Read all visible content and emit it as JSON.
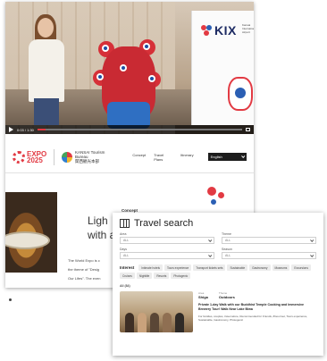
{
  "video": {
    "time": "0:03 / 1:30",
    "progress": 0.04,
    "kix_logo_text": "KIX",
    "kix_subtitle": "Kansai International Airport"
  },
  "site": {
    "expo_line1": "EXPO",
    "expo_line2": "2025",
    "kb_line1": "KANSAI Tourism Bureau",
    "kb_line2": "関西観光本部",
    "nav": [
      "Concept",
      "Travel Plans",
      "Itinerary"
    ],
    "language": "English",
    "hero_line1": "Ligh",
    "hero_line2": "with a tri",
    "concept_label": "Concept",
    "copy_line1": "The World Expo is c",
    "copy_line2": "the theme of \"Desig",
    "copy_line3": "Our Lifes\". The even"
  },
  "travel_search": {
    "title": "Travel search",
    "fields": [
      {
        "label": "Area",
        "value": "ALL"
      },
      {
        "label": "Theme",
        "value": "ALL"
      },
      {
        "label": "Days",
        "value": "ALL"
      },
      {
        "label": "Season",
        "value": "ALL"
      }
    ],
    "interest_label": "Interest",
    "chips": [
      "Intimate hotels",
      "Tours experience",
      "Transport tickets sets",
      "Sustainable",
      "Gastronomy",
      "Museums",
      "Excursions",
      "Cruises",
      "Nightlife",
      "Resorts",
      "Photogenic"
    ],
    "results_label": "All (84)",
    "card": {
      "area_label": "Area",
      "area_value": "Shiga",
      "theme_label": "Theme",
      "theme_value": "Outdoors",
      "title": "Private 1-day Walk with our Buddhist Temple Cooking and Immersive Brewery Tour! Walk Near Lake Biwa",
      "tags": "For families, couples, travel alone, Recommended for Friends, #Gourmet, Tours experience, Sustainable, Gastronomy, Photogenic"
    }
  },
  "colors": {
    "expo_red": "#e23a43",
    "kix_navy": "#1d2b63"
  }
}
